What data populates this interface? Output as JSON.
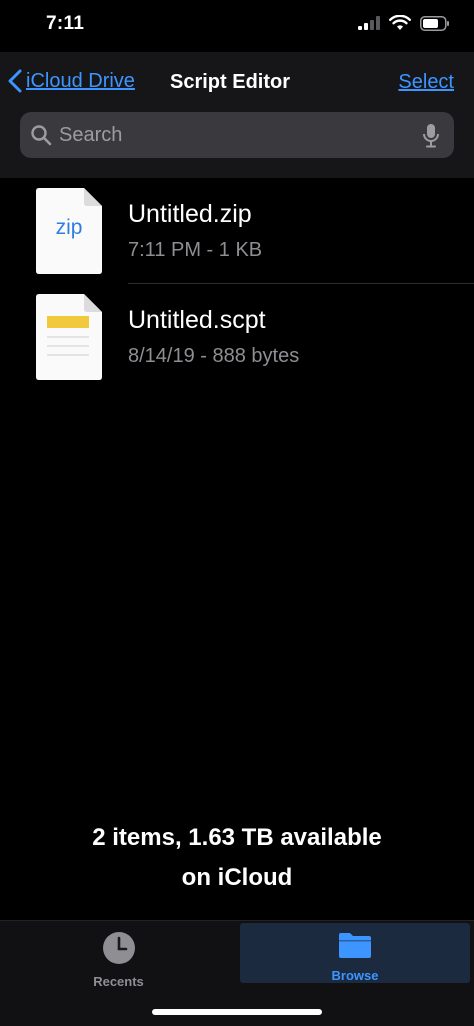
{
  "status_bar": {
    "time": "7:11"
  },
  "header": {
    "back_label": "iCloud Drive",
    "title": "Script Editor",
    "select_label": "Select"
  },
  "search": {
    "placeholder": "Search"
  },
  "files": [
    {
      "name": "Untitled.zip",
      "meta": "7:11 PM - 1 KB",
      "thumb_label": "zip",
      "icon": "zip-file-icon"
    },
    {
      "name": "Untitled.scpt",
      "meta": "8/14/19 - 888 bytes",
      "icon": "script-file-icon"
    }
  ],
  "footer": {
    "line1": "2 items, 1.63 TB available",
    "line2": "on iCloud"
  },
  "tabs": [
    {
      "label": "Recents",
      "icon": "clock-icon",
      "selected": false
    },
    {
      "label": "Browse",
      "icon": "folder-icon",
      "selected": true
    }
  ],
  "colors": {
    "accent": "#3d95ff",
    "background": "#000000",
    "header_bg": "#161618",
    "secondary_text": "#8e8e93"
  }
}
